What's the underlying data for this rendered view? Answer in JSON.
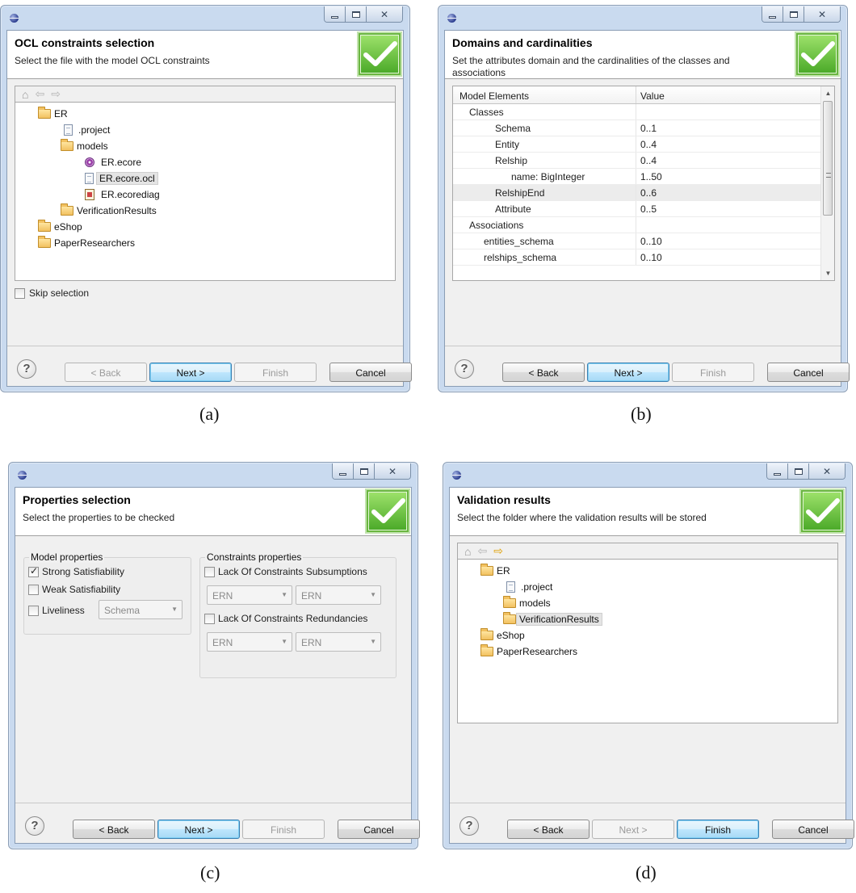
{
  "colors": {
    "accent": "#3c7fb1",
    "check_green": "#4aa928"
  },
  "panels": {
    "a": {
      "caption": "(a)",
      "title": "OCL constraints selection",
      "description": "Select the file with the model OCL constraints",
      "tree": [
        "ER",
        ".project",
        "models",
        "ER.ecore",
        "ER.ecore.ocl",
        "ER.ecorediag",
        "VerificationResults",
        "eShop",
        "PaperResearchers"
      ],
      "skip_label": "Skip selection",
      "buttons": {
        "back": "< Back",
        "next": "Next >",
        "finish": "Finish",
        "cancel": "Cancel"
      }
    },
    "b": {
      "caption": "(b)",
      "title": "Domains and cardinalities",
      "description": "Set the attributes domain and the cardinalities of the classes and associations",
      "table": {
        "headers": [
          "Model Elements",
          "Value"
        ],
        "rows": [
          {
            "name": "Classes",
            "value": ""
          },
          {
            "name": "Schema",
            "value": "0..1"
          },
          {
            "name": "Entity",
            "value": "0..4"
          },
          {
            "name": "Relship",
            "value": "0..4"
          },
          {
            "name": "name: BigInteger",
            "value": "1..50"
          },
          {
            "name": "RelshipEnd",
            "value": "0..6"
          },
          {
            "name": "Attribute",
            "value": "0..5"
          },
          {
            "name": "Associations",
            "value": ""
          },
          {
            "name": "entities_schema",
            "value": "0..10"
          },
          {
            "name": "relships_schema",
            "value": "0..10"
          }
        ]
      },
      "buttons": {
        "back": "< Back",
        "next": "Next >",
        "finish": "Finish",
        "cancel": "Cancel"
      }
    },
    "c": {
      "caption": "(c)",
      "title": "Properties selection",
      "description": "Select the properties to be checked",
      "model_group": "Model properties",
      "strong": "Strong Satisfiability",
      "weak": "Weak Satisfiability",
      "liveliness": "Liveliness",
      "liveliness_value": "Schema",
      "constraints_group": "Constraints properties",
      "subsumptions": "Lack Of Constraints Subsumptions",
      "redundancies": "Lack Of Constraints Redundancies",
      "combo_value": "ERN",
      "buttons": {
        "back": "< Back",
        "next": "Next >",
        "finish": "Finish",
        "cancel": "Cancel"
      }
    },
    "d": {
      "caption": "(d)",
      "title": "Validation results",
      "description": "Select the folder where the validation results will be stored",
      "tree": [
        "ER",
        ".project",
        "models",
        "VerificationResults",
        "eShop",
        "PaperResearchers"
      ],
      "buttons": {
        "back": "< Back",
        "next": "Next >",
        "finish": "Finish",
        "cancel": "Cancel"
      }
    }
  }
}
